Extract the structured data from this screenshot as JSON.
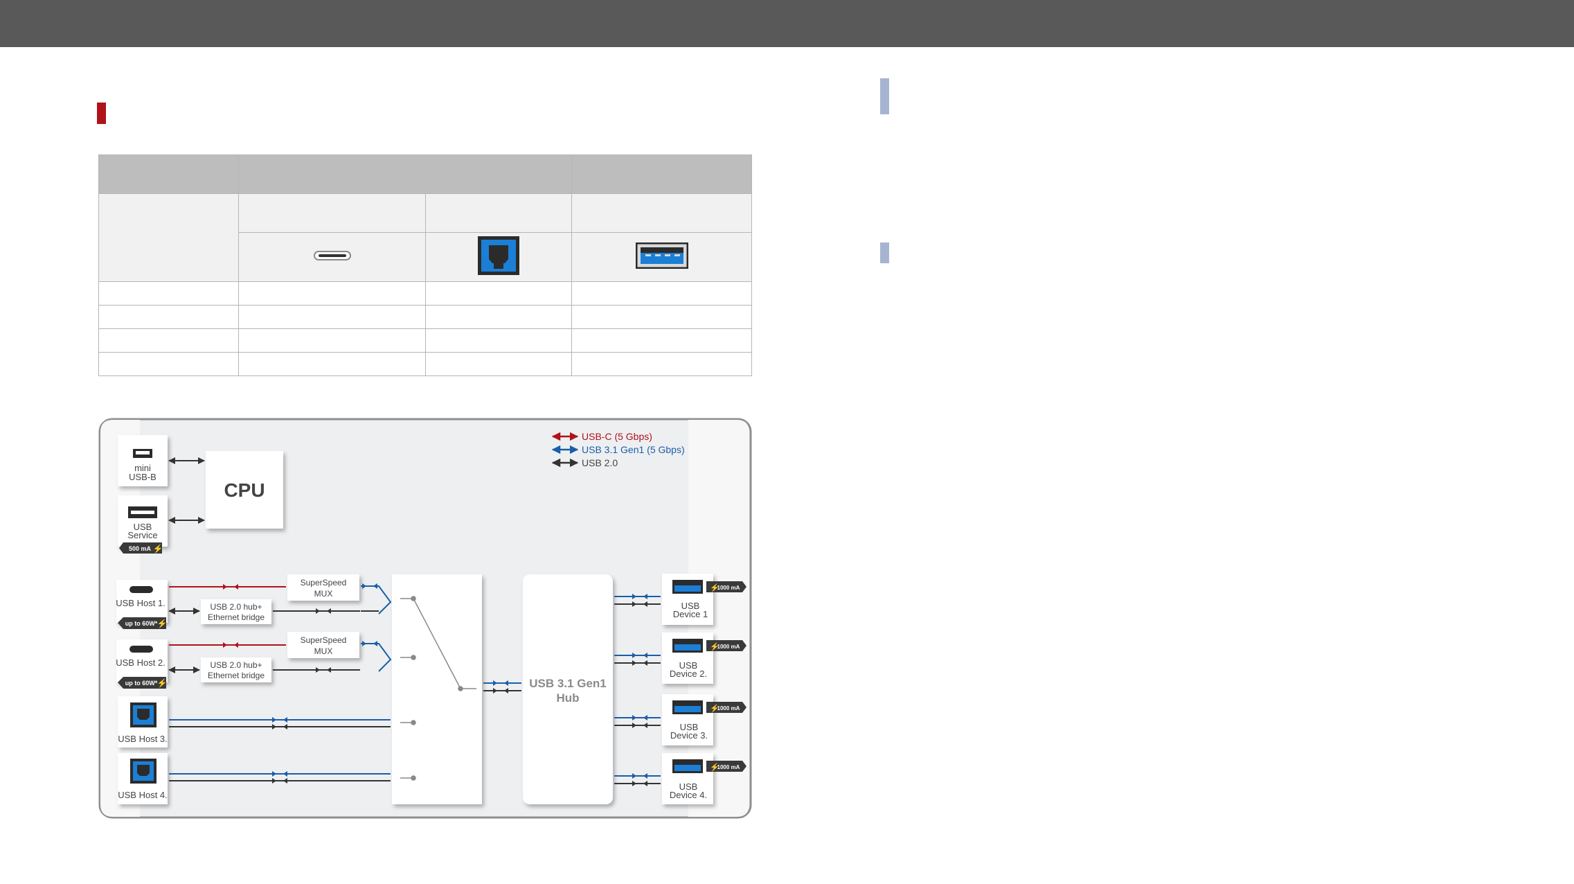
{
  "colors": {
    "topbar": "#595959",
    "section_marker": "#b0121b",
    "side_marker": "#a7b4d1",
    "usb_c": "#b0121b",
    "usb31": "#1a5ea8",
    "usb20": "#333333",
    "connector_blue": "#1c7fd6"
  },
  "diagram": {
    "legend": {
      "usbc": "USB-C (5 Gbps)",
      "usb31": "USB 3.1 Gen1 (5 Gbps)",
      "usb20": "USB 2.0"
    },
    "cpu": "CPU",
    "mini_usb": [
      "mini",
      "USB-B"
    ],
    "usb_service": [
      "USB",
      "Service"
    ],
    "service_current": "500 mA",
    "hosts": [
      "USB Host 1.",
      "USB Host 2.",
      "USB Host 3.",
      "USB Host 4."
    ],
    "host_power": "up to 60W*",
    "mux": [
      "SuperSpeed",
      "MUX"
    ],
    "bridge": [
      "USB 2.0 hub+",
      "Ethernet bridge"
    ],
    "hub": [
      "USB 3.1 Gen1",
      "Hub"
    ],
    "devices": [
      [
        "USB",
        "Device 1"
      ],
      [
        "USB",
        "Device 2."
      ],
      [
        "USB",
        "Device 3."
      ],
      [
        "USB",
        "Device 4."
      ]
    ],
    "device_current": "1000 mA"
  }
}
